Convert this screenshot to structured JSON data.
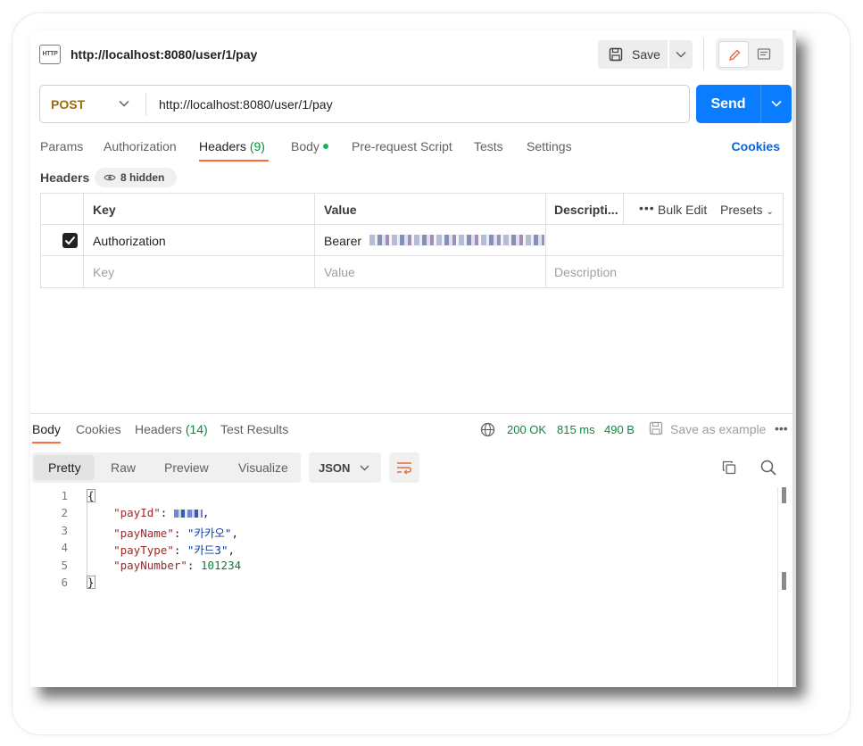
{
  "tab": {
    "title": "http://localhost:8080/user/1/pay",
    "icon_label": "HTTP"
  },
  "toolbar": {
    "save_label": "Save"
  },
  "request": {
    "method": "POST",
    "url": "http://localhost:8080/user/1/pay",
    "send_label": "Send"
  },
  "request_tabs": {
    "params": "Params",
    "authorization": "Authorization",
    "headers": "Headers",
    "headers_count": "(9)",
    "body": "Body",
    "prerequest": "Pre-request Script",
    "tests": "Tests",
    "settings": "Settings",
    "cookies": "Cookies"
  },
  "headers_section": {
    "label": "Headers",
    "hidden": "8 hidden"
  },
  "headers_table": {
    "columns": {
      "key": "Key",
      "value": "Value",
      "description": "Descripti...",
      "bulk_edit": "Bulk Edit",
      "presets": "Presets"
    },
    "rows": [
      {
        "key": "Authorization",
        "value": "Bearer",
        "checked": true
      }
    ],
    "placeholders": {
      "key": "Key",
      "value": "Value",
      "description": "Description"
    }
  },
  "response": {
    "tabs": {
      "body": "Body",
      "cookies": "Cookies",
      "headers": "Headers",
      "headers_count": "(14)",
      "tests": "Test Results"
    },
    "status": "200 OK",
    "time": "815 ms",
    "size": "490 B",
    "save_example": "Save as example",
    "views": [
      "Pretty",
      "Raw",
      "Preview",
      "Visualize"
    ],
    "format": "JSON",
    "line_numbers": [
      "1",
      "2",
      "3",
      "4",
      "5",
      "6"
    ],
    "json": {
      "open": "{",
      "close": "}",
      "payId_key": "\"payId\"",
      "payName_key": "\"payName\"",
      "payName_val": "\"카카오\"",
      "payType_key": "\"payType\"",
      "payType_val": "\"카드3\"",
      "payNumber_key": "\"payNumber\"",
      "payNumber_val": "101234"
    }
  },
  "colors": {
    "accent": "#ff6c37",
    "send": "#0a7cff",
    "method": "#a06a00",
    "status_ok": "#0c8a3c"
  }
}
